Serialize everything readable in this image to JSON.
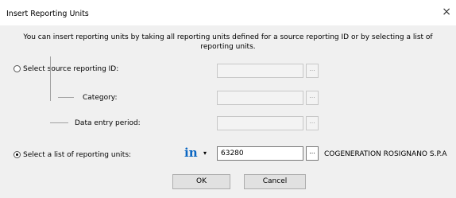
{
  "window": {
    "title": "Insert Reporting Units",
    "close_glyph": "×"
  },
  "description": "You can insert reporting units by taking all reporting units defined for a source reporting ID or by selecting a list of reporting units.",
  "options": {
    "source_id_label": "Select source reporting ID:",
    "category_label": "Category:",
    "period_label": "Data entry period:",
    "list_label": "Select a list of reporting units:",
    "selected": "list"
  },
  "fields": {
    "source_id": "",
    "category": "",
    "period": "",
    "unit_value": "63280",
    "unit_name": "COGENERATION ROSIGNANO S.P.A"
  },
  "browse_label": "...",
  "icons": {
    "in_icon": "in",
    "dropdown": "▾"
  },
  "buttons": {
    "ok": "OK",
    "cancel": "Cancel"
  },
  "colors": {
    "accent": "#0a66c2",
    "dialog_bg": "#f0f0f0"
  }
}
